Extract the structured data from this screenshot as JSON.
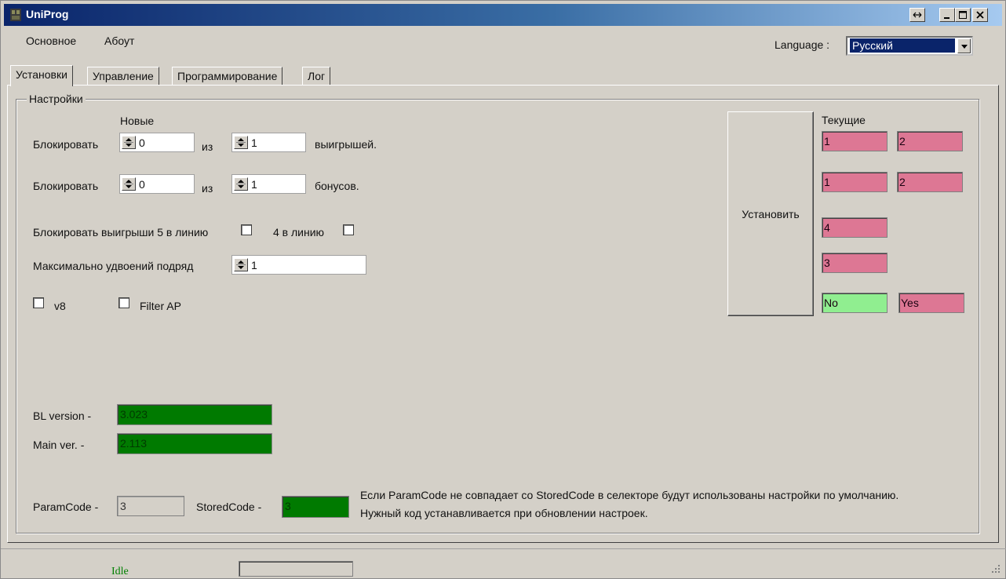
{
  "window": {
    "title": "UniProg"
  },
  "menu": {
    "items": [
      {
        "label": "Основное"
      },
      {
        "label": "Абоут"
      }
    ]
  },
  "language": {
    "label": "Language :",
    "selected": "Русский"
  },
  "tabs": [
    {
      "label": "Установки",
      "active": true
    },
    {
      "label": "Управление",
      "active": false
    },
    {
      "label": "Программирование",
      "active": false
    },
    {
      "label": "Лог",
      "active": false
    }
  ],
  "settings": {
    "group_title": "Настройки",
    "new_header": "Новые",
    "current_header": "Текущие",
    "block_wins": {
      "label": "Блокировать",
      "value_a": "0",
      "of": "из",
      "value_b": "1",
      "suffix": "выигрышей."
    },
    "block_bonus": {
      "label": "Блокировать",
      "value_a": "0",
      "of": "из",
      "value_b": "1",
      "suffix": "бонусов."
    },
    "block_5_line": {
      "label": "Блокировать выигрыши 5 в линию",
      "checked": false
    },
    "block_4_line": {
      "label": "4 в линию",
      "checked": false
    },
    "max_doubles": {
      "label": "Максимально удвоений подряд",
      "value": "1"
    },
    "v8": {
      "label": "v8",
      "checked": false
    },
    "filter_ap": {
      "label": "Filter AP",
      "checked": false
    },
    "set_button": "Установить",
    "current": {
      "wins_a": "1",
      "wins_b": "2",
      "bonus_a": "1",
      "bonus_b": "2",
      "lines": "4",
      "max_doubles": "3",
      "v8": "No",
      "filter_ap": "Yes"
    },
    "bl_version": {
      "label": "BL version -",
      "value": "3.023"
    },
    "main_version": {
      "label": "Main ver. -",
      "value": "2.113"
    },
    "param_code": {
      "label": "ParamCode -",
      "value": "3"
    },
    "stored_code": {
      "label": "StoredCode -",
      "value": "3"
    },
    "note_line1": "Если ParamCode не совпадает со StoredCode в селекторе будут использованы настройки по умолчанию.",
    "note_line2": "Нужный код устанавливается при обновлении настроек."
  },
  "status": {
    "text": "Idle"
  },
  "colors": {
    "current_value_bg": "#dd7794",
    "current_no_bg": "#90ee90",
    "version_bg": "#007a00",
    "title_gradient_start": "#0a246a"
  }
}
